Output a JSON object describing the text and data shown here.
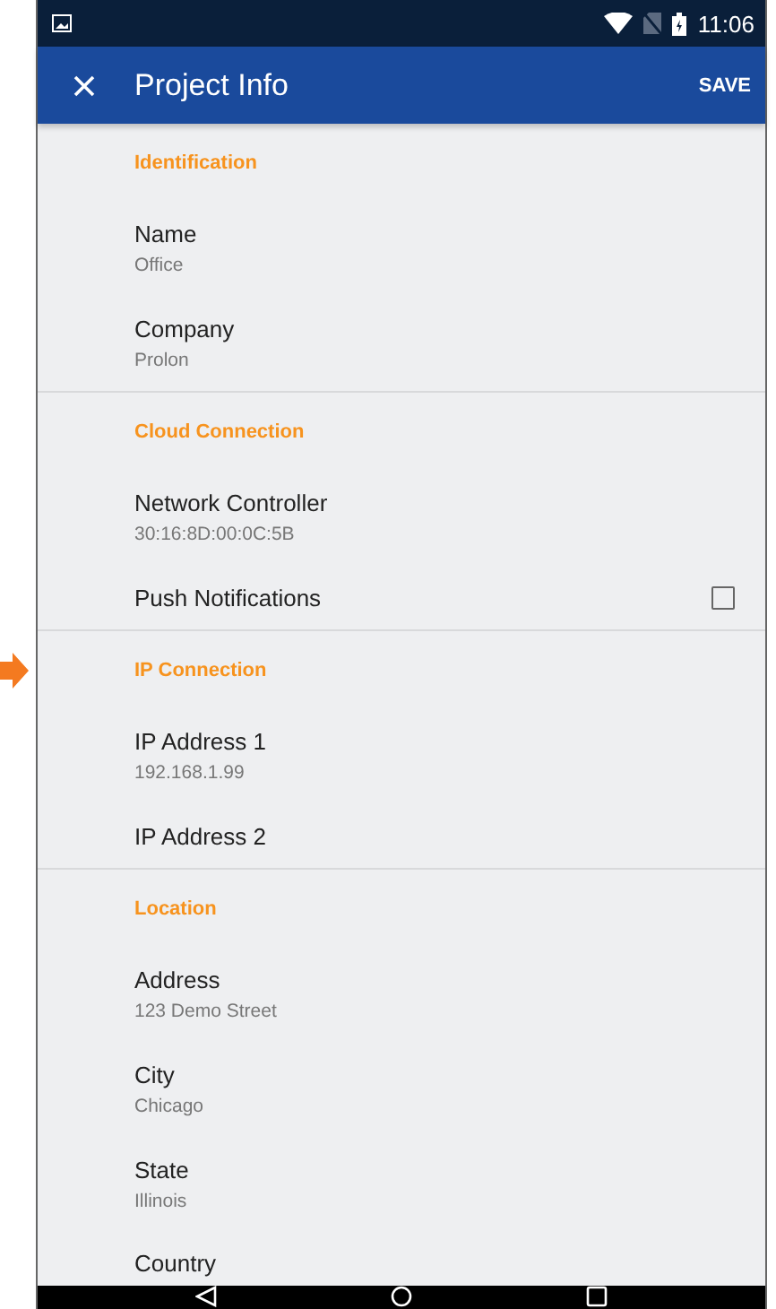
{
  "status_bar": {
    "time": "11:06"
  },
  "app_bar": {
    "title": "Project Info",
    "action": "SAVE"
  },
  "sections": [
    {
      "title": "Identification",
      "items": [
        {
          "kind": "text",
          "label": "Name",
          "value": "Office"
        },
        {
          "kind": "text",
          "label": "Company",
          "value": "Prolon"
        }
      ]
    },
    {
      "title": "Cloud Connection",
      "items": [
        {
          "kind": "text",
          "label": "Network Controller",
          "value": "30:16:8D:00:0C:5B"
        },
        {
          "kind": "checkbox",
          "label": "Push Notifications",
          "checked": false
        }
      ]
    },
    {
      "title": "IP Connection",
      "pointed": true,
      "items": [
        {
          "kind": "text",
          "label": "IP Address 1",
          "value": "192.168.1.99"
        },
        {
          "kind": "text",
          "label": "IP Address 2"
        }
      ]
    },
    {
      "title": "Location",
      "items": [
        {
          "kind": "text",
          "label": "Address",
          "value": "123 Demo Street"
        },
        {
          "kind": "text",
          "label": "City",
          "value": "Chicago"
        },
        {
          "kind": "text",
          "label": "State",
          "value": "Illinois"
        },
        {
          "kind": "text",
          "label": "Country"
        }
      ]
    }
  ]
}
